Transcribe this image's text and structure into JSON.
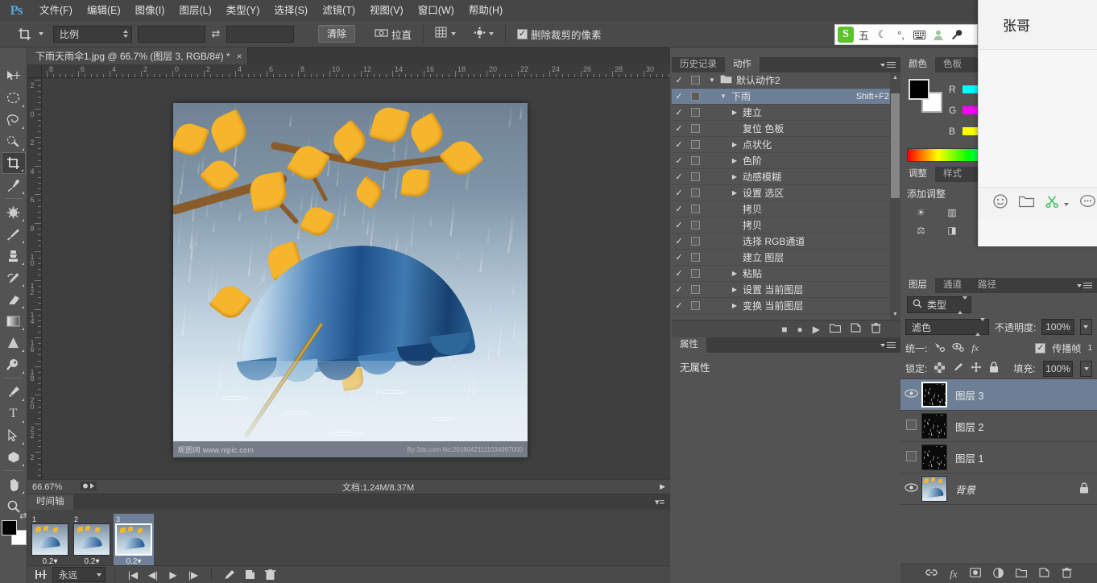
{
  "app": {
    "name": "Photoshop",
    "logo": "Ps"
  },
  "menubar": {
    "items": [
      {
        "label": "文件(F)",
        "name": "menu-file"
      },
      {
        "label": "编辑(E)",
        "name": "menu-edit"
      },
      {
        "label": "图像(I)",
        "name": "menu-image"
      },
      {
        "label": "图层(L)",
        "name": "menu-layer"
      },
      {
        "label": "类型(Y)",
        "name": "menu-type"
      },
      {
        "label": "选择(S)",
        "name": "menu-select"
      },
      {
        "label": "滤镜(T)",
        "name": "menu-filter"
      },
      {
        "label": "视图(V)",
        "name": "menu-view"
      },
      {
        "label": "窗口(W)",
        "name": "menu-window"
      },
      {
        "label": "帮助(H)",
        "name": "menu-help"
      }
    ]
  },
  "optionsbar": {
    "tool_icon": "crop-tool-icon",
    "ratio_select": "比例",
    "width_value": "",
    "width_placeholder": "",
    "swap_icon": "swap-arrows-icon",
    "height_value": "",
    "height_placeholder": "",
    "clear_button": "清除",
    "straighten_icon": "straighten-icon",
    "straighten_label": "拉直",
    "overlay_icon": "grid-overlay-icon",
    "settings_icon": "gear-icon",
    "delete_cropped_checked": true,
    "delete_cropped_label": "删除裁剪的像素",
    "reset_icon": "reset-arrow-icon"
  },
  "ime": {
    "logo": "S",
    "items": [
      {
        "name": "ime-mode-icon",
        "glyph": "五"
      },
      {
        "name": "ime-moon-icon",
        "glyph": "☾"
      },
      {
        "name": "ime-punctuation-icon",
        "glyph": "°,"
      },
      {
        "name": "ime-keyboard-icon",
        "glyph": "⌨"
      },
      {
        "name": "ime-user-icon",
        "glyph": "☻"
      },
      {
        "name": "ime-tools-icon",
        "glyph": "🔧"
      }
    ]
  },
  "toolbar": {
    "tools": [
      {
        "name": "move-tool",
        "glyph": "✥",
        "active": false,
        "corner": false
      },
      {
        "name": "elliptical-marquee-tool",
        "glyph": "◯",
        "active": false,
        "corner": true
      },
      {
        "name": "lasso-tool",
        "glyph": "𝒫",
        "active": false,
        "corner": true
      },
      {
        "name": "quick-selection-tool",
        "glyph": "✦",
        "active": false,
        "corner": true
      },
      {
        "name": "crop-tool",
        "glyph": "⌗",
        "active": true,
        "corner": true
      },
      {
        "name": "eyedropper-tool",
        "glyph": "✒",
        "active": false,
        "corner": true
      },
      {
        "name": "spot-healing-brush-tool",
        "glyph": "✸",
        "active": false,
        "corner": true
      },
      {
        "name": "brush-tool",
        "glyph": "🖌",
        "active": false,
        "corner": true
      },
      {
        "name": "clone-stamp-tool",
        "glyph": "⚑",
        "active": false,
        "corner": true
      },
      {
        "name": "history-brush-tool",
        "glyph": "❧",
        "active": false,
        "corner": true
      },
      {
        "name": "eraser-tool",
        "glyph": "▰",
        "active": false,
        "corner": true
      },
      {
        "name": "gradient-tool",
        "glyph": "▤",
        "active": false,
        "corner": true
      },
      {
        "name": "blur-tool",
        "glyph": "▲",
        "active": false,
        "corner": true
      },
      {
        "name": "dodge-tool",
        "glyph": "◗",
        "active": false,
        "corner": true
      },
      {
        "name": "pen-tool",
        "glyph": "✎",
        "active": false,
        "corner": true
      },
      {
        "name": "horizontal-type-tool",
        "glyph": "T",
        "active": false,
        "corner": true
      },
      {
        "name": "path-selection-tool",
        "glyph": "➤",
        "active": false,
        "corner": true
      },
      {
        "name": "polygon-tool",
        "glyph": "⬣",
        "active": false,
        "corner": true
      },
      {
        "name": "hand-tool",
        "glyph": "✋",
        "active": false,
        "corner": true
      },
      {
        "name": "zoom-tool",
        "glyph": "🔍",
        "active": false,
        "corner": false
      }
    ],
    "foreground_color": "#000000",
    "background_color": "#ffffff",
    "swap_icon": "swap-colors-icon"
  },
  "document": {
    "tab_title": "下雨天雨伞1.jpg @ 66.7% (图层 3, RGB/8#) *",
    "close_icon": "close-icon",
    "zoom_level": "66.67%",
    "doc_info": "文档:1.24M/8.37M",
    "ruler_h_labels": [
      "8",
      "6",
      "4",
      "2",
      "0",
      "2",
      "4",
      "6",
      "8",
      "10",
      "12",
      "14",
      "16",
      "18",
      "20",
      "22",
      "24",
      "26",
      "28",
      "30"
    ],
    "ruler_v_labels": [
      "2",
      "0",
      "2",
      "4",
      "6",
      "8",
      "10",
      "12",
      "14",
      "16",
      "18",
      "20",
      "22",
      "2"
    ],
    "watermark_left": "昵图网 www.nipic.com",
    "watermark_right": "By:3ds.com No:20180421111034997000"
  },
  "history_actions_panel": {
    "tabs": [
      {
        "label": "历史记录",
        "name": "tab-history",
        "active": false
      },
      {
        "label": "动作",
        "name": "tab-actions",
        "active": true
      }
    ],
    "menu_icon": "panel-menu-icon",
    "rows": [
      {
        "label": "默认动作2",
        "indent": 0,
        "folder": true,
        "expand": "down",
        "checked": true,
        "selected": false,
        "shortcut": ""
      },
      {
        "label": "下雨",
        "indent": 1,
        "folder": false,
        "expand": "down",
        "checked": true,
        "selected": true,
        "shortcut": "Shift+F2"
      },
      {
        "label": "建立",
        "indent": 2,
        "folder": false,
        "expand": "right",
        "checked": true,
        "selected": false,
        "shortcut": ""
      },
      {
        "label": "复位 色板",
        "indent": 2,
        "folder": false,
        "expand": "",
        "checked": true,
        "selected": false,
        "shortcut": ""
      },
      {
        "label": "点状化",
        "indent": 2,
        "folder": false,
        "expand": "right",
        "checked": true,
        "selected": false,
        "shortcut": ""
      },
      {
        "label": "色阶",
        "indent": 2,
        "folder": false,
        "expand": "right",
        "checked": true,
        "selected": false,
        "shortcut": ""
      },
      {
        "label": "动感模糊",
        "indent": 2,
        "folder": false,
        "expand": "right",
        "checked": true,
        "selected": false,
        "shortcut": ""
      },
      {
        "label": "设置 选区",
        "indent": 2,
        "folder": false,
        "expand": "right",
        "checked": true,
        "selected": false,
        "shortcut": ""
      },
      {
        "label": "拷贝",
        "indent": 2,
        "folder": false,
        "expand": "",
        "checked": true,
        "selected": false,
        "shortcut": ""
      },
      {
        "label": "拷贝",
        "indent": 2,
        "folder": false,
        "expand": "",
        "checked": true,
        "selected": false,
        "shortcut": ""
      },
      {
        "label": "选择 RGB通道",
        "indent": 2,
        "folder": false,
        "expand": "",
        "checked": true,
        "selected": false,
        "shortcut": ""
      },
      {
        "label": "建立 图层",
        "indent": 2,
        "folder": false,
        "expand": "",
        "checked": true,
        "selected": false,
        "shortcut": ""
      },
      {
        "label": "粘贴",
        "indent": 2,
        "folder": false,
        "expand": "right",
        "checked": true,
        "selected": false,
        "shortcut": ""
      },
      {
        "label": "设置 当前图层",
        "indent": 2,
        "folder": false,
        "expand": "right",
        "checked": true,
        "selected": false,
        "shortcut": ""
      },
      {
        "label": "变换 当前图层",
        "indent": 2,
        "folder": false,
        "expand": "right",
        "checked": true,
        "selected": false,
        "shortcut": ""
      }
    ],
    "footer_icons": [
      {
        "name": "stop-recording-icon",
        "glyph": "■"
      },
      {
        "name": "begin-recording-icon",
        "glyph": "●"
      },
      {
        "name": "play-selection-icon",
        "glyph": "▶"
      },
      {
        "name": "new-set-icon",
        "glyph": "🗀"
      },
      {
        "name": "new-action-icon",
        "glyph": "❏"
      },
      {
        "name": "delete-icon",
        "glyph": "🗑"
      }
    ]
  },
  "properties_panel": {
    "tab_label": "属性",
    "menu_icon": "panel-menu-icon",
    "empty_text": "无属性"
  },
  "color_panel": {
    "tabs": [
      {
        "label": "颜色",
        "name": "tab-color",
        "active": true
      },
      {
        "label": "色板",
        "name": "tab-swatches",
        "active": false
      }
    ],
    "foreground_color": "#000000",
    "background_color": "#ffffff",
    "channels": [
      {
        "label": "R",
        "start": "#00ffff",
        "end": "#00e8e8"
      },
      {
        "label": "G",
        "start": "#ff00ff",
        "end": "#f000f0"
      },
      {
        "label": "B",
        "start": "#ffff00",
        "end": "#e8e800"
      }
    ]
  },
  "adjustments_panel": {
    "tabs": [
      {
        "label": "调整",
        "name": "tab-adjustments",
        "active": true
      },
      {
        "label": "样式",
        "name": "tab-styles",
        "active": false
      }
    ],
    "title": "添加调整",
    "icons": [
      {
        "name": "brightness-contrast-icon",
        "glyph": "☀"
      },
      {
        "name": "levels-icon",
        "glyph": "▥"
      },
      {
        "name": "curves-icon",
        "glyph": "∿"
      },
      {
        "name": "exposure-icon",
        "glyph": "◐"
      },
      {
        "name": "vibrance-icon",
        "glyph": "▽"
      },
      {
        "name": "hue-saturation-icon",
        "glyph": "◑"
      },
      {
        "name": "color-balance-icon",
        "glyph": "⚖"
      },
      {
        "name": "black-white-icon",
        "glyph": "◨"
      },
      {
        "name": "photo-filter-icon",
        "glyph": "◉"
      },
      {
        "name": "channel-mixer-icon",
        "glyph": "▦"
      },
      {
        "name": "color-lookup-icon",
        "glyph": "▣"
      },
      {
        "name": "invert-icon",
        "glyph": "◱"
      }
    ]
  },
  "layers_panel": {
    "tabs": [
      {
        "label": "图层",
        "name": "tab-layers",
        "active": true
      },
      {
        "label": "通道",
        "name": "tab-channels",
        "active": false
      },
      {
        "label": "路径",
        "name": "tab-paths",
        "active": false
      }
    ],
    "filter_icon": "search-icon",
    "filter_type": "类型",
    "blend_mode": "滤色",
    "opacity_label": "不透明度:",
    "opacity_value": "100%",
    "unify_label": "统一:",
    "unify_icons": [
      {
        "name": "unify-position-icon",
        "glyph": "✛"
      },
      {
        "name": "unify-visibility-icon",
        "glyph": "◉"
      },
      {
        "name": "unify-style-icon",
        "glyph": "fx"
      }
    ],
    "propagate_checked": true,
    "propagate_label": "传播帧",
    "propagate_count": "1",
    "lock_label": "锁定:",
    "lock_icons": [
      {
        "name": "lock-transparency-icon",
        "glyph": "▨"
      },
      {
        "name": "lock-image-icon",
        "glyph": "🖌"
      },
      {
        "name": "lock-position-icon",
        "glyph": "✛"
      },
      {
        "name": "lock-all-icon",
        "glyph": "🔒"
      }
    ],
    "fill_label": "填充:",
    "fill_value": "100%",
    "layers": [
      {
        "name": "图层 3",
        "visible": true,
        "selected": true,
        "locked": false,
        "thumb": "black-noise",
        "italic": false
      },
      {
        "name": "图层 2",
        "visible": false,
        "selected": false,
        "locked": false,
        "thumb": "black-noise",
        "italic": false
      },
      {
        "name": "图层 1",
        "visible": false,
        "selected": false,
        "locked": false,
        "thumb": "black-noise",
        "italic": false
      },
      {
        "name": "背景",
        "visible": true,
        "selected": false,
        "locked": true,
        "thumb": "photo",
        "italic": true
      }
    ],
    "footer_icons": [
      {
        "name": "link-layers-icon",
        "glyph": "🔗"
      },
      {
        "name": "layer-style-icon",
        "glyph": "fx"
      },
      {
        "name": "layer-mask-icon",
        "glyph": "◰"
      },
      {
        "name": "adjustment-layer-icon",
        "glyph": "◑"
      },
      {
        "name": "new-group-icon",
        "glyph": "🗀"
      },
      {
        "name": "new-layer-icon",
        "glyph": "❏"
      },
      {
        "name": "delete-layer-icon",
        "glyph": "🗑"
      }
    ]
  },
  "timeline_panel": {
    "tab_label": "时间轴",
    "menu_icon": "panel-menu-icon",
    "frames": [
      {
        "number": "1",
        "delay": "0.2",
        "selected": false
      },
      {
        "number": "2",
        "delay": "0.2",
        "selected": false
      },
      {
        "number": "3",
        "delay": "0.2",
        "selected": true
      }
    ],
    "tween_icon": "tween-frames-icon",
    "loop_option": "永远",
    "controls": [
      {
        "name": "select-first-frame-button",
        "glyph": "|◀"
      },
      {
        "name": "select-previous-frame-button",
        "glyph": "◀|"
      },
      {
        "name": "play-animation-button",
        "glyph": "▶"
      },
      {
        "name": "select-next-frame-button",
        "glyph": "|▶"
      }
    ],
    "right_controls": [
      {
        "name": "tween-animation-button",
        "glyph": "✎"
      },
      {
        "name": "duplicate-frame-button",
        "glyph": "❏"
      },
      {
        "name": "delete-frame-button",
        "glyph": "🗑"
      }
    ]
  },
  "chat_window": {
    "title": "张哥",
    "toolbar_icons": [
      {
        "name": "emoji-icon",
        "glyph": "☺"
      },
      {
        "name": "folder-icon",
        "glyph": "🗀"
      },
      {
        "name": "screenshot-scissors-icon",
        "glyph": "✂"
      },
      {
        "name": "message-icon",
        "glyph": "💬"
      }
    ]
  },
  "colors": {
    "panel_bg": "#535353",
    "panel_dark": "#3d3d3d",
    "selection_blue": "#6d7f96",
    "accent_green": "#5ec22a",
    "text": "#e0e0e0"
  }
}
